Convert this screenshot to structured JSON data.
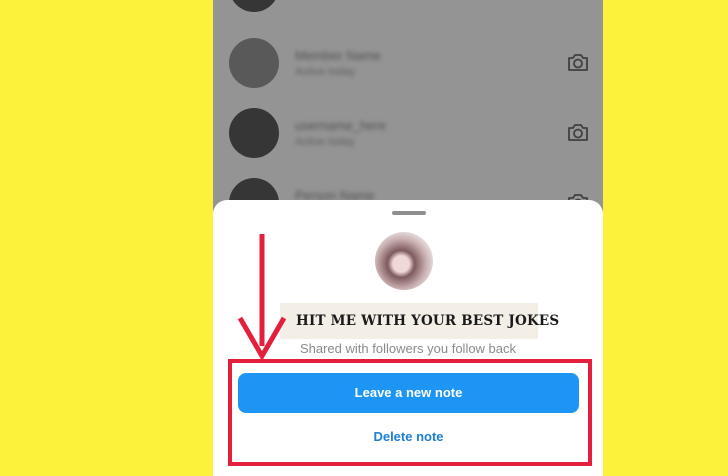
{
  "background": {
    "color": "#fdf23b"
  },
  "conversations": [
    {
      "name": "",
      "subtitle": "",
      "icon": "camera-icon"
    },
    {
      "name": "Member Name",
      "subtitle": "Active today",
      "icon": "camera-icon"
    },
    {
      "name": "username_here",
      "subtitle": "Active today",
      "icon": "camera-icon"
    },
    {
      "name": "Person Name",
      "subtitle": "",
      "icon": "camera-icon"
    }
  ],
  "sheet": {
    "note_text": "HIT ME WITH YOUR BEST JOKES",
    "audience_text": "Shared with followers you follow back",
    "primary_button_label": "Leave a new note",
    "secondary_button_label": "Delete note"
  },
  "annotation": {
    "color": "#e41f3c"
  },
  "colors": {
    "primary": "#1d95f5",
    "link": "#1d7fd6"
  }
}
